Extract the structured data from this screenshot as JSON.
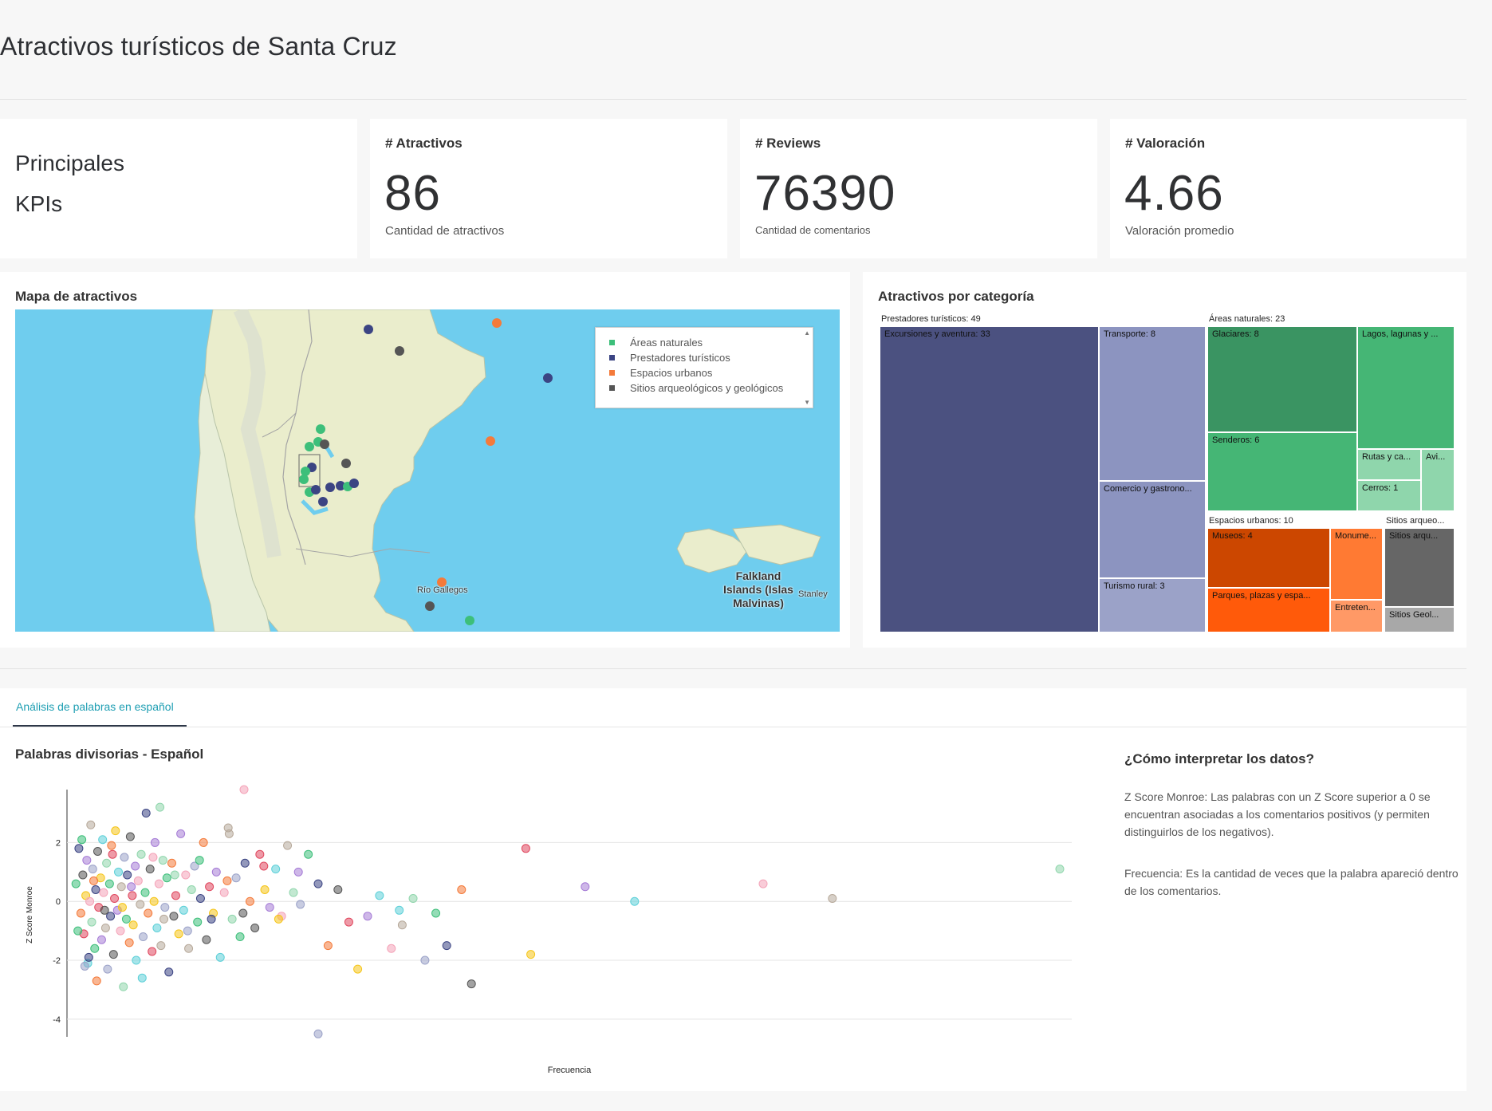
{
  "page_title": "Atractivos turísticos de Santa Cruz",
  "kpis": {
    "intro_line1": "Principales",
    "intro_line2": "KPIs",
    "cards": [
      {
        "label": "# Atractivos",
        "value": "86",
        "sub": "Cantidad de atractivos"
      },
      {
        "label": "# Reviews",
        "value": "76390",
        "sub": "Cantidad de comentarios"
      },
      {
        "label": "# Valoración",
        "value": "4.66",
        "sub": "Valoración promedio"
      }
    ]
  },
  "map_panel": {
    "title": "Mapa de atractivos",
    "legend": [
      {
        "label": "Áreas naturales",
        "color": "#3dbf7a"
      },
      {
        "label": "Prestadores turísticos",
        "color": "#3b4483"
      },
      {
        "label": "Espacios urbanos",
        "color": "#f47a3a"
      },
      {
        "label": "Sitios arqueológicos y geológicos",
        "color": "#555555"
      }
    ],
    "labels": {
      "city": "Río Gallegos",
      "islands": "Falkland Islands (Islas Malvinas)",
      "islands_l1": "Falkland",
      "islands_l2": "Islands (Islas",
      "islands_l3": "Malvinas)",
      "capital": "Stanley"
    }
  },
  "treemap_panel": {
    "title": "Atractivos por categoría",
    "groups": {
      "prestadores": "Prestadores turísticos: 49",
      "areas": "Áreas naturales: 23",
      "espacios": "Espacios urbanos: 10",
      "sitios": "Sitios arqueo..."
    },
    "cells": {
      "excursiones": "Excursiones y aventura: 33",
      "transporte": "Transporte: 8",
      "comercio": "Comercio y gastrono...",
      "turismo_rural": "Turismo rural: 3",
      "glaciares": "Glaciares: 8",
      "lagos": "Lagos, lagunas y ...",
      "senderos": "Senderos: 6",
      "rutas": "Rutas y ca...",
      "avi": "Avi...",
      "cerros": "Cerros: 1",
      "museos": "Museos: 4",
      "monume": "Monume...",
      "parques": "Parques, plazas y espa...",
      "entreten": "Entreten...",
      "sitios_arq": "Sitios arqu...",
      "sitios_geol": "Sitios Geol..."
    },
    "colors": {
      "excursiones": "#4b5180",
      "transporte": "#8c94c0",
      "comercio": "#8c94c0",
      "turismo_rural": "#9ba2c8",
      "glaciares": "#3a9462",
      "lagos": "#45b675",
      "senderos": "#45b675",
      "rutas": "#8fd6ac",
      "avi": "#8fd6ac",
      "cerros": "#8fd6ac",
      "museos": "#cc4700",
      "monume": "#ff7a33",
      "parques": "#ff5a0a",
      "entreten": "#ff9966",
      "sitios_arq": "#666666",
      "sitios_geol": "#a8a8a8"
    }
  },
  "tabs": [
    {
      "label": "Análisis de palabras en español",
      "active": true
    }
  ],
  "scatter_panel": {
    "title": "Palabras divisorias - Español"
  },
  "info": {
    "title": "¿Cómo interpretar los datos?",
    "p1": "Z Score Monroe: Las palabras con un Z Score superior a 0 se encuentran asociadas a los comentarios positivos (y permiten distinguirlos de los negativos).",
    "p2": "Frecuencia: Es la cantidad de veces que la palabra apareció dentro de los comentarios."
  },
  "chart_data": {
    "type": "scatter",
    "xlabel": "Frecuencia",
    "ylabel": "Z Score Monroe",
    "yticks": [
      2,
      0,
      -2,
      -4
    ],
    "ylim": [
      -4.6,
      3.8
    ],
    "xlim": [
      0,
      100
    ],
    "grid": true,
    "palette": [
      "#3dbf7a",
      "#3b4483",
      "#f47a3a",
      "#555555",
      "#e0475e",
      "#f5c518",
      "#a57bd6",
      "#5dd0d8",
      "#f4a3b8",
      "#b7a99a",
      "#8fd6ac",
      "#9ba2c8"
    ],
    "points": [
      {
        "x": 0.5,
        "y": 0.6
      },
      {
        "x": 0.8,
        "y": 1.8
      },
      {
        "x": 1.0,
        "y": -0.4
      },
      {
        "x": 1.2,
        "y": 0.9
      },
      {
        "x": 1.3,
        "y": -1.1
      },
      {
        "x": 1.5,
        "y": 0.2
      },
      {
        "x": 1.6,
        "y": 1.4
      },
      {
        "x": 1.7,
        "y": -2.1
      },
      {
        "x": 1.9,
        "y": 0.0
      },
      {
        "x": 2.0,
        "y": 2.6
      },
      {
        "x": 2.1,
        "y": -0.7
      },
      {
        "x": 2.2,
        "y": 1.1
      },
      {
        "x": 2.4,
        "y": -1.6
      },
      {
        "x": 2.5,
        "y": 0.4
      },
      {
        "x": 2.6,
        "y": -2.7
      },
      {
        "x": 2.7,
        "y": 1.7
      },
      {
        "x": 2.8,
        "y": -0.2
      },
      {
        "x": 3.0,
        "y": 0.8
      },
      {
        "x": 3.1,
        "y": -1.3
      },
      {
        "x": 3.2,
        "y": 2.1
      },
      {
        "x": 3.3,
        "y": 0.3
      },
      {
        "x": 3.5,
        "y": -0.9
      },
      {
        "x": 3.6,
        "y": 1.3
      },
      {
        "x": 3.7,
        "y": -2.3
      },
      {
        "x": 3.9,
        "y": 0.6
      },
      {
        "x": 4.0,
        "y": -0.5
      },
      {
        "x": 4.1,
        "y": 1.9
      },
      {
        "x": 4.3,
        "y": -1.8
      },
      {
        "x": 4.4,
        "y": 0.1
      },
      {
        "x": 4.5,
        "y": 2.4
      },
      {
        "x": 4.7,
        "y": -0.3
      },
      {
        "x": 4.8,
        "y": 1.0
      },
      {
        "x": 5.0,
        "y": -1.0
      },
      {
        "x": 5.1,
        "y": 0.5
      },
      {
        "x": 5.3,
        "y": -2.9
      },
      {
        "x": 5.4,
        "y": 1.5
      },
      {
        "x": 5.6,
        "y": -0.6
      },
      {
        "x": 5.7,
        "y": 0.9
      },
      {
        "x": 5.9,
        "y": -1.4
      },
      {
        "x": 6.0,
        "y": 2.2
      },
      {
        "x": 6.2,
        "y": 0.2
      },
      {
        "x": 6.3,
        "y": -0.8
      },
      {
        "x": 6.5,
        "y": 1.2
      },
      {
        "x": 6.6,
        "y": -2.0
      },
      {
        "x": 6.8,
        "y": 0.7
      },
      {
        "x": 7.0,
        "y": -0.1
      },
      {
        "x": 7.1,
        "y": 1.6
      },
      {
        "x": 7.3,
        "y": -1.2
      },
      {
        "x": 7.5,
        "y": 0.3
      },
      {
        "x": 7.6,
        "y": 3.0
      },
      {
        "x": 7.8,
        "y": -0.4
      },
      {
        "x": 8.0,
        "y": 1.1
      },
      {
        "x": 8.2,
        "y": -1.7
      },
      {
        "x": 8.4,
        "y": 0.0
      },
      {
        "x": 8.5,
        "y": 2.0
      },
      {
        "x": 8.7,
        "y": -0.9
      },
      {
        "x": 8.9,
        "y": 0.6
      },
      {
        "x": 9.1,
        "y": -1.5
      },
      {
        "x": 9.3,
        "y": 1.4
      },
      {
        "x": 9.5,
        "y": -0.2
      },
      {
        "x": 9.7,
        "y": 0.8
      },
      {
        "x": 9.9,
        "y": -2.4
      },
      {
        "x": 10.2,
        "y": 1.3
      },
      {
        "x": 10.4,
        "y": -0.5
      },
      {
        "x": 10.6,
        "y": 0.2
      },
      {
        "x": 10.9,
        "y": -1.1
      },
      {
        "x": 11.1,
        "y": 2.3
      },
      {
        "x": 11.4,
        "y": -0.3
      },
      {
        "x": 11.6,
        "y": 0.9
      },
      {
        "x": 11.9,
        "y": -1.6
      },
      {
        "x": 12.2,
        "y": 0.4
      },
      {
        "x": 12.5,
        "y": 1.2
      },
      {
        "x": 12.8,
        "y": -0.7
      },
      {
        "x": 13.1,
        "y": 0.1
      },
      {
        "x": 13.4,
        "y": 2.0
      },
      {
        "x": 13.7,
        "y": -1.3
      },
      {
        "x": 14.0,
        "y": 0.5
      },
      {
        "x": 14.4,
        "y": -0.4
      },
      {
        "x": 14.7,
        "y": 1.0
      },
      {
        "x": 15.1,
        "y": -1.9
      },
      {
        "x": 15.5,
        "y": 0.3
      },
      {
        "x": 15.9,
        "y": 2.5
      },
      {
        "x": 16.3,
        "y": -0.6
      },
      {
        "x": 16.7,
        "y": 0.8
      },
      {
        "x": 17.1,
        "y": -1.2
      },
      {
        "x": 17.6,
        "y": 1.3
      },
      {
        "x": 18.1,
        "y": 0.0
      },
      {
        "x": 18.6,
        "y": -0.9
      },
      {
        "x": 19.1,
        "y": 1.6
      },
      {
        "x": 19.6,
        "y": 0.4
      },
      {
        "x": 20.1,
        "y": -0.2
      },
      {
        "x": 20.7,
        "y": 1.1
      },
      {
        "x": 21.3,
        "y": -0.5
      },
      {
        "x": 21.9,
        "y": 1.9
      },
      {
        "x": 22.5,
        "y": 0.3
      },
      {
        "x": 23.2,
        "y": -0.1
      },
      {
        "x": 24.0,
        "y": 1.6
      },
      {
        "x": 25.0,
        "y": 0.6
      },
      {
        "x": 26.0,
        "y": -1.5
      },
      {
        "x": 27.0,
        "y": 0.4
      },
      {
        "x": 28.1,
        "y": -0.7
      },
      {
        "x": 29.0,
        "y": -2.3
      },
      {
        "x": 30.0,
        "y": -0.5
      },
      {
        "x": 31.2,
        "y": 0.2
      },
      {
        "x": 32.4,
        "y": -1.6
      },
      {
        "x": 33.5,
        "y": -0.8
      },
      {
        "x": 34.6,
        "y": 0.1
      },
      {
        "x": 35.8,
        "y": -2.0
      },
      {
        "x": 36.9,
        "y": -0.4
      },
      {
        "x": 38.0,
        "y": -1.5
      },
      {
        "x": 39.5,
        "y": 0.4
      },
      {
        "x": 40.5,
        "y": -2.8
      },
      {
        "x": 46.0,
        "y": 1.8
      },
      {
        "x": 46.5,
        "y": -1.8
      },
      {
        "x": 52.0,
        "y": 0.5
      },
      {
        "x": 57.0,
        "y": 0.0
      },
      {
        "x": 70.0,
        "y": 0.6
      },
      {
        "x": 77.0,
        "y": 0.1
      },
      {
        "x": 100.0,
        "y": 1.1
      },
      {
        "x": 25.0,
        "y": -4.5
      },
      {
        "x": 1.1,
        "y": 2.1
      },
      {
        "x": 1.8,
        "y": -1.9
      },
      {
        "x": 2.3,
        "y": 0.7
      },
      {
        "x": 3.4,
        "y": -0.3
      },
      {
        "x": 4.2,
        "y": 1.6
      },
      {
        "x": 5.2,
        "y": -0.2
      },
      {
        "x": 6.1,
        "y": 0.5
      },
      {
        "x": 7.2,
        "y": -2.6
      },
      {
        "x": 8.3,
        "y": 1.5
      },
      {
        "x": 9.4,
        "y": -0.6
      },
      {
        "x": 10.5,
        "y": 0.9
      },
      {
        "x": 11.8,
        "y": -1.0
      },
      {
        "x": 13.0,
        "y": 1.4
      },
      {
        "x": 14.2,
        "y": -0.6
      },
      {
        "x": 15.8,
        "y": 0.7
      },
      {
        "x": 17.4,
        "y": -0.4
      },
      {
        "x": 19.5,
        "y": 1.2
      },
      {
        "x": 21.0,
        "y": -0.6
      },
      {
        "x": 23.0,
        "y": 1.0
      },
      {
        "x": 33.2,
        "y": -0.3
      },
      {
        "x": 17.5,
        "y": 3.8
      },
      {
        "x": 16.0,
        "y": 2.3
      },
      {
        "x": 9.0,
        "y": 3.2
      },
      {
        "x": 1.4,
        "y": -2.2
      },
      {
        "x": 0.7,
        "y": -1.0
      }
    ]
  }
}
